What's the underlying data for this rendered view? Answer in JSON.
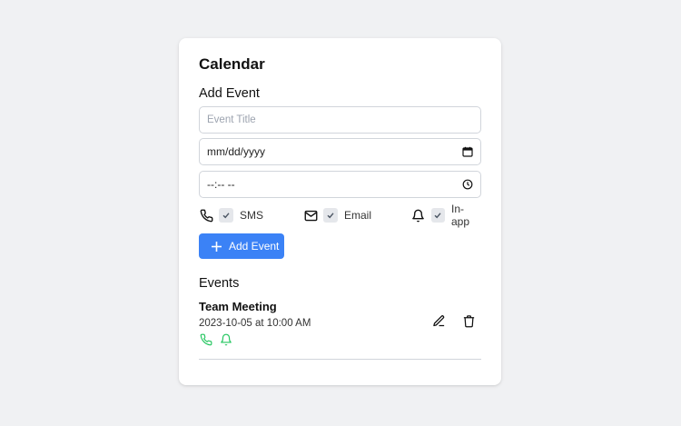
{
  "calendar": {
    "title": "Calendar",
    "add_event_heading": "Add Event",
    "title_placeholder": "Event Title",
    "date_value": "mm/dd/yyyy",
    "time_value": "--:-- --",
    "notifications": [
      {
        "icon": "phone-icon",
        "label": "SMS",
        "checked": true
      },
      {
        "icon": "mail-icon",
        "label": "Email",
        "checked": true
      },
      {
        "icon": "bell-icon",
        "label": "In-app",
        "checked": true
      }
    ],
    "add_button_label": "Add Event",
    "accent_color": "#3b82f6",
    "notify_icon_color": "#22c55e"
  },
  "events": {
    "heading": "Events",
    "items": [
      {
        "title": "Team Meeting",
        "datetime": "2023-10-05 at 10:00 AM",
        "notify_icons": [
          "phone-icon",
          "bell-icon"
        ]
      }
    ]
  }
}
